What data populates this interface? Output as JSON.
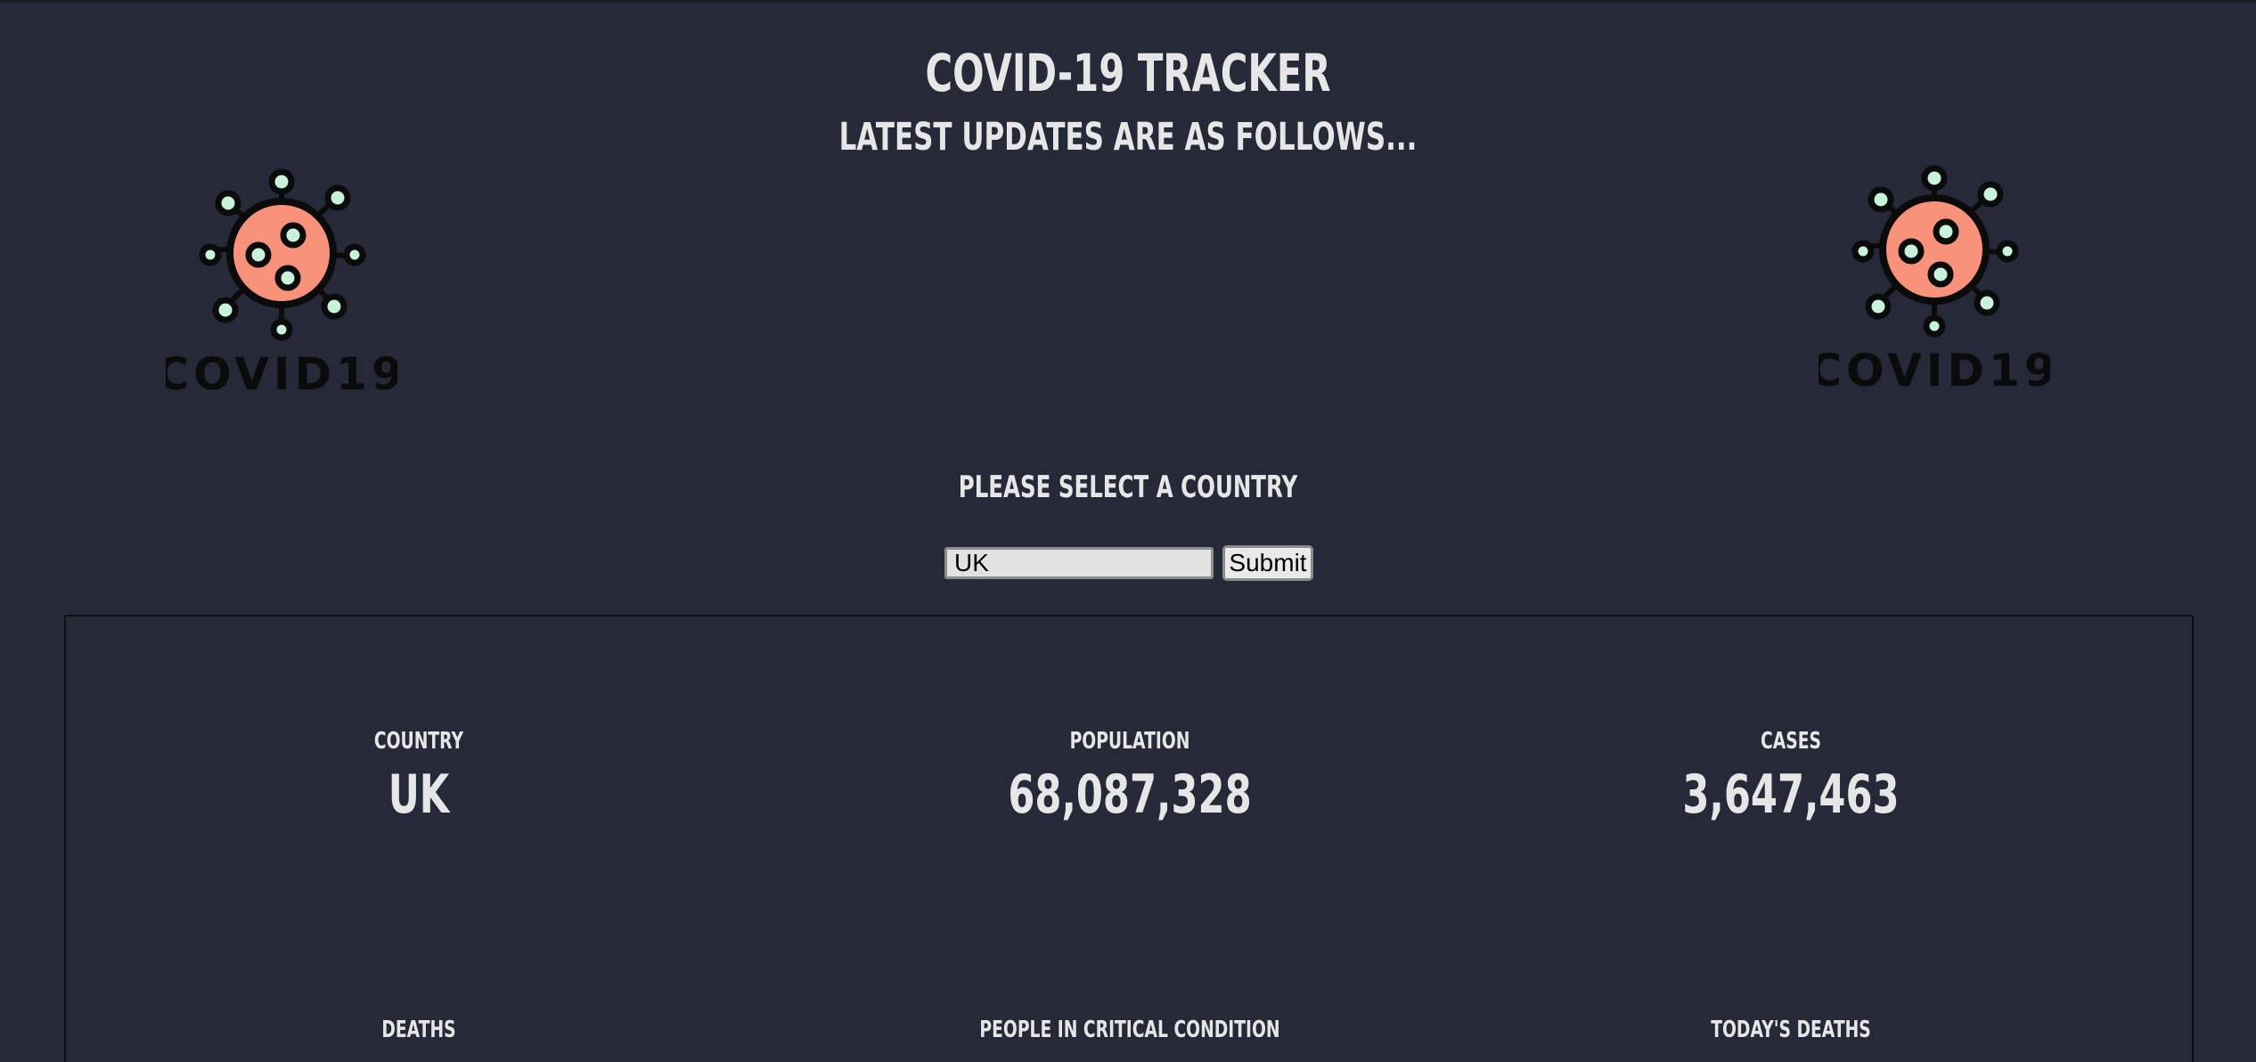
{
  "header": {
    "title": "COVID-19 Tracker",
    "subtitle": "Latest updates are as follows..."
  },
  "logos": {
    "left_icon": "covid19-virus-icon",
    "right_icon": "covid19-virus-icon",
    "logo_text": "COVID19",
    "colors": {
      "virus_body": "#f8927a",
      "outline": "#0b0b0b",
      "dots": "#c9f2dc"
    }
  },
  "search": {
    "label": "Please select a country",
    "value": "UK",
    "submit_label": "Submit"
  },
  "stats": {
    "country": {
      "label": "Country",
      "value": "UK"
    },
    "population": {
      "label": "Population",
      "value": "68,087,328"
    },
    "cases": {
      "label": "Cases",
      "value": "3,647,463"
    },
    "deaths": {
      "label": "Deaths"
    },
    "critical": {
      "label": "People in critical condition"
    },
    "today_deaths": {
      "label": "Today's deaths"
    }
  },
  "colors": {
    "background": "#252938",
    "text": "#e6e6e6",
    "panel_border": "#0e0f15"
  }
}
